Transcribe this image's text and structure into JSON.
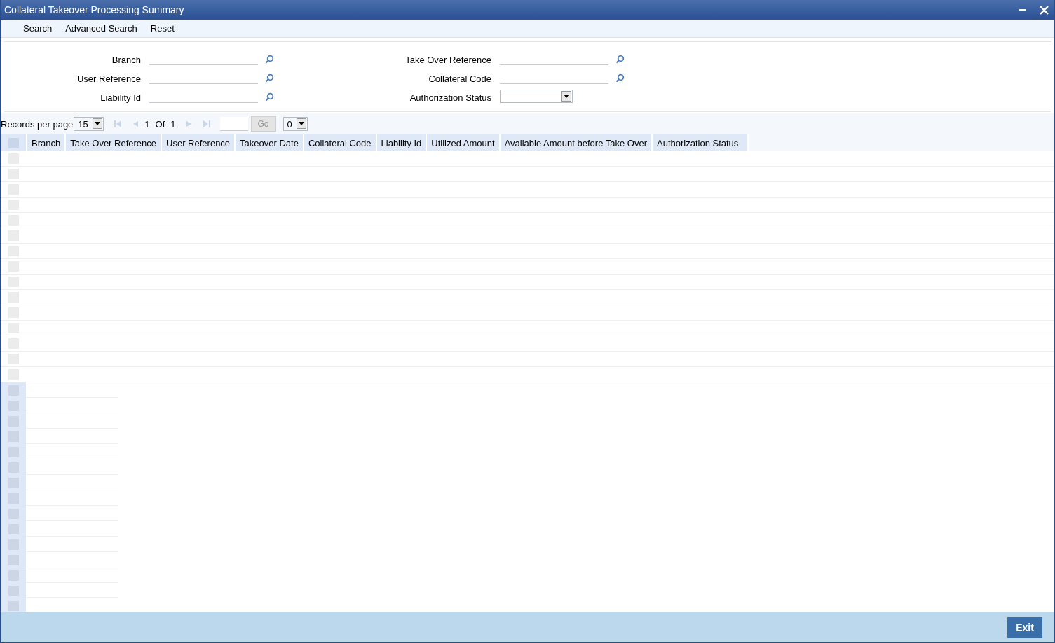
{
  "window": {
    "title": "Collateral Takeover Processing Summary"
  },
  "toolbar": [
    "Search",
    "Advanced Search",
    "Reset"
  ],
  "search_fields": {
    "left": [
      {
        "label": "Branch",
        "kind": "lookup"
      },
      {
        "label": "User Reference",
        "kind": "lookup"
      },
      {
        "label": "Liability Id",
        "kind": "lookup"
      }
    ],
    "right": [
      {
        "label": "Take Over Reference",
        "kind": "lookup"
      },
      {
        "label": "Collateral Code",
        "kind": "lookup"
      },
      {
        "label": "Authorization Status",
        "kind": "select"
      }
    ]
  },
  "pager": {
    "records_label": "Records per page",
    "records_value": "15",
    "page": "1",
    "of": "Of",
    "total": "1",
    "go": "Go",
    "options_value": "0"
  },
  "table": {
    "select_all": {
      "checked": false
    },
    "rows": [
      {
        "checked": false
      },
      {
        "checked": false
      },
      {
        "checked": false
      },
      {
        "checked": false
      },
      {
        "checked": false
      },
      {
        "checked": false
      },
      {
        "checked": false
      },
      {
        "checked": false
      },
      {
        "checked": false
      },
      {
        "checked": false
      },
      {
        "checked": false
      },
      {
        "checked": false
      },
      {
        "checked": false
      },
      {
        "checked": false
      },
      {
        "checked": false
      }
    ],
    "columns": [
      "Branch",
      "Take Over Reference",
      "User Reference",
      "Takeover Date",
      "Collateral Code",
      "Liability Id",
      "Utilized Amount",
      "Available Amount before Take Over",
      "Authorization Status"
    ]
  },
  "footer": {
    "button": "Exit"
  }
}
